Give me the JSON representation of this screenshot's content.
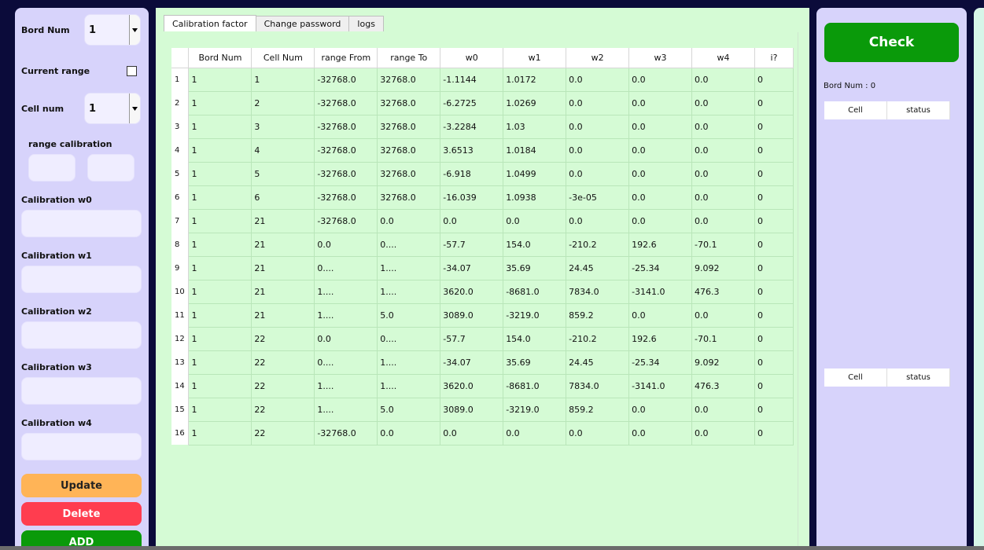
{
  "left": {
    "bord_num_label": "Bord Num",
    "bord_num_value": "1",
    "current_range_label": "Current range",
    "cell_num_label": "Cell num",
    "cell_num_value": "1",
    "range_calibration_label": "range calibration",
    "w0_label": "Calibration w0",
    "w1_label": "Calibration w1",
    "w2_label": "Calibration w2",
    "w3_label": "Calibration w3",
    "w4_label": "Calibration w4",
    "update_label": "Update",
    "delete_label": "Delete",
    "add_label": "ADD"
  },
  "tabs": [
    "Calibration factor",
    "Change password",
    "logs"
  ],
  "table": {
    "headers": [
      "Bord Num",
      "Cell Num",
      "range From",
      "range To",
      "w0",
      "w1",
      "w2",
      "w3",
      "w4",
      "i?"
    ],
    "rows": [
      [
        "1",
        "1",
        "-32768.0",
        "32768.0",
        "-1.1144",
        "1.0172",
        "0.0",
        "0.0",
        "0.0",
        "0"
      ],
      [
        "1",
        "2",
        "-32768.0",
        "32768.0",
        "-6.2725",
        "1.0269",
        "0.0",
        "0.0",
        "0.0",
        "0"
      ],
      [
        "1",
        "3",
        "-32768.0",
        "32768.0",
        "-3.2284",
        "1.03",
        "0.0",
        "0.0",
        "0.0",
        "0"
      ],
      [
        "1",
        "4",
        "-32768.0",
        "32768.0",
        "3.6513",
        "1.0184",
        "0.0",
        "0.0",
        "0.0",
        "0"
      ],
      [
        "1",
        "5",
        "-32768.0",
        "32768.0",
        "-6.918",
        "1.0499",
        "0.0",
        "0.0",
        "0.0",
        "0"
      ],
      [
        "1",
        "6",
        "-32768.0",
        "32768.0",
        "-16.039",
        "1.0938",
        "-3e-05",
        "0.0",
        "0.0",
        "0"
      ],
      [
        "1",
        "21",
        "-32768.0",
        "0.0",
        "0.0",
        "0.0",
        "0.0",
        "0.0",
        "0.0",
        "0"
      ],
      [
        "1",
        "21",
        "0.0",
        "0....",
        "-57.7",
        "154.0",
        "-210.2",
        "192.6",
        "-70.1",
        "0"
      ],
      [
        "1",
        "21",
        "0....",
        "1....",
        "-34.07",
        "35.69",
        "24.45",
        "-25.34",
        "9.092",
        "0"
      ],
      [
        "1",
        "21",
        "1....",
        "1....",
        "3620.0",
        "-8681.0",
        "7834.0",
        "-3141.0",
        "476.3",
        "0"
      ],
      [
        "1",
        "21",
        "1....",
        "5.0",
        "3089.0",
        "-3219.0",
        "859.2",
        "0.0",
        "0.0",
        "0"
      ],
      [
        "1",
        "22",
        "0.0",
        "0....",
        "-57.7",
        "154.0",
        "-210.2",
        "192.6",
        "-70.1",
        "0"
      ],
      [
        "1",
        "22",
        "0....",
        "1....",
        "-34.07",
        "35.69",
        "24.45",
        "-25.34",
        "9.092",
        "0"
      ],
      [
        "1",
        "22",
        "1....",
        "1....",
        "3620.0",
        "-8681.0",
        "7834.0",
        "-3141.0",
        "476.3",
        "0"
      ],
      [
        "1",
        "22",
        "1....",
        "5.0",
        "3089.0",
        "-3219.0",
        "859.2",
        "0.0",
        "0.0",
        "0"
      ],
      [
        "1",
        "22",
        "-32768.0",
        "0.0",
        "0.0",
        "0.0",
        "0.0",
        "0.0",
        "0.0",
        "0"
      ]
    ]
  },
  "right": {
    "check_label": "Check",
    "bord_num_text": "Bord Num : 0",
    "table1": [
      "Cell",
      "status"
    ],
    "table2": [
      "Cell",
      "status"
    ]
  },
  "colors": {
    "panel_purple": "#d7d3fb",
    "panel_green": "#d5fbd5",
    "update": "#ffb457",
    "delete": "#ff3d4f",
    "add": "#0a9a0a",
    "check": "#0a9a0a"
  }
}
